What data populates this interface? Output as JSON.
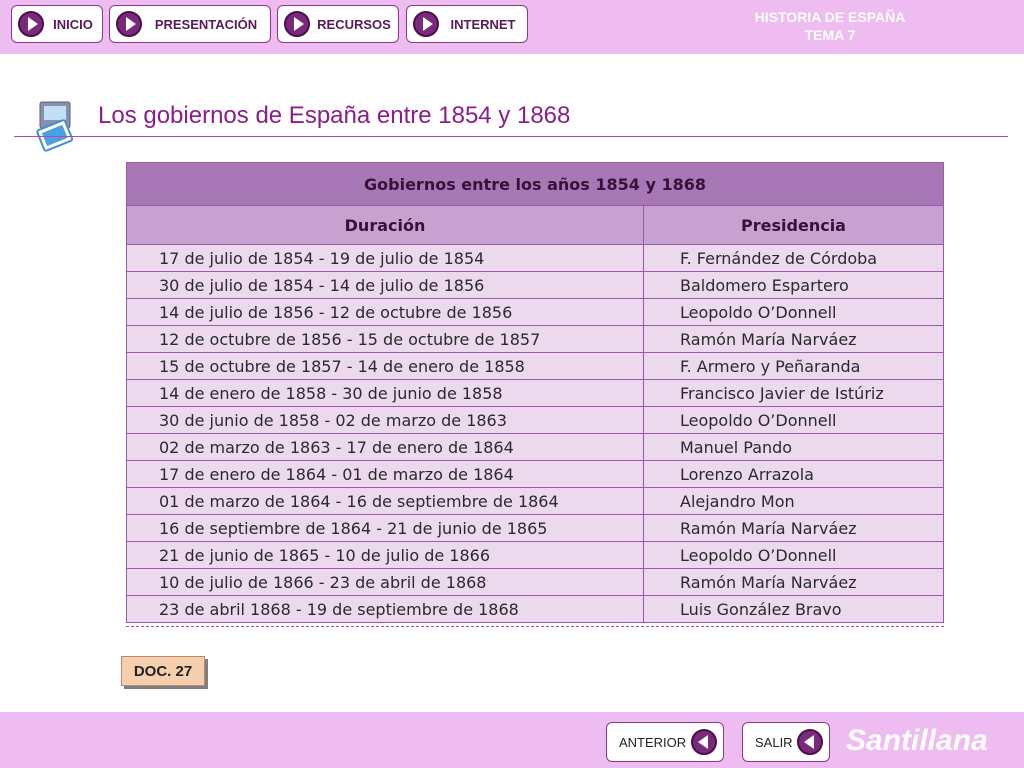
{
  "nav": {
    "inicio": "INICIO",
    "presentacion": "PRESENTACIÓN",
    "recursos": "RECURSOS",
    "internet": "INTERNET"
  },
  "header": {
    "line1": "HISTORIA DE ESPAÑA",
    "line2": "TEMA 7"
  },
  "page": {
    "title": "Los gobiernos de España entre 1854 y 1868"
  },
  "table": {
    "caption": "Gobiernos entre los años 1854 y 1868",
    "columns": [
      "Duración",
      "Presidencia"
    ],
    "rows": [
      [
        "17 de julio de 1854 - 19 de julio de 1854",
        "F. Fernández de Córdoba"
      ],
      [
        "30 de julio de 1854 - 14 de julio de 1856",
        "Baldomero Espartero"
      ],
      [
        "14 de julio de 1856 - 12 de octubre de 1856",
        "Leopoldo O’Donnell"
      ],
      [
        "12 de octubre de 1856 - 15 de octubre de 1857",
        "Ramón María Narváez"
      ],
      [
        "15 de octubre de 1857 - 14 de enero de 1858",
        "F. Armero y Peñaranda"
      ],
      [
        "14 de enero de 1858 - 30 de junio de 1858",
        "Francisco Javier de Istúriz"
      ],
      [
        "30 de junio de 1858 - 02 de marzo de 1863",
        "Leopoldo O’Donnell"
      ],
      [
        "02 de marzo de 1863 - 17 de enero de 1864",
        "Manuel Pando"
      ],
      [
        "17 de enero de 1864 -  01 de marzo de 1864",
        "Lorenzo Arrazola"
      ],
      [
        "01 de marzo de 1864 - 16 de septiembre de 1864",
        "Alejandro Mon"
      ],
      [
        "16 de septiembre de 1864 - 21 de junio de 1865",
        "Ramón María Narváez"
      ],
      [
        "21 de junio de 1865 - 10 de julio de 1866",
        "Leopoldo O’Donnell"
      ],
      [
        "10 de julio de 1866 - 23 de abril de 1868",
        "Ramón María Narváez"
      ],
      [
        "23 de abril 1868 - 19 de septiembre de 1868",
        "Luis González Bravo"
      ]
    ]
  },
  "doc_label": "DOC. 27",
  "footer": {
    "anterior": "ANTERIOR",
    "salir": "SALIR",
    "brand": "Santillana"
  },
  "colors": {
    "bar": "#eebcf0",
    "accent": "#8a1e8a",
    "table_caption": "#a878b6",
    "table_header": "#c7a1cf",
    "table_row": "#ecd9ee"
  },
  "icons": {
    "nav_arrow": "play-arrow-icon",
    "back_arrow": "back-arrow-icon",
    "title_icon": "slides-icon"
  }
}
